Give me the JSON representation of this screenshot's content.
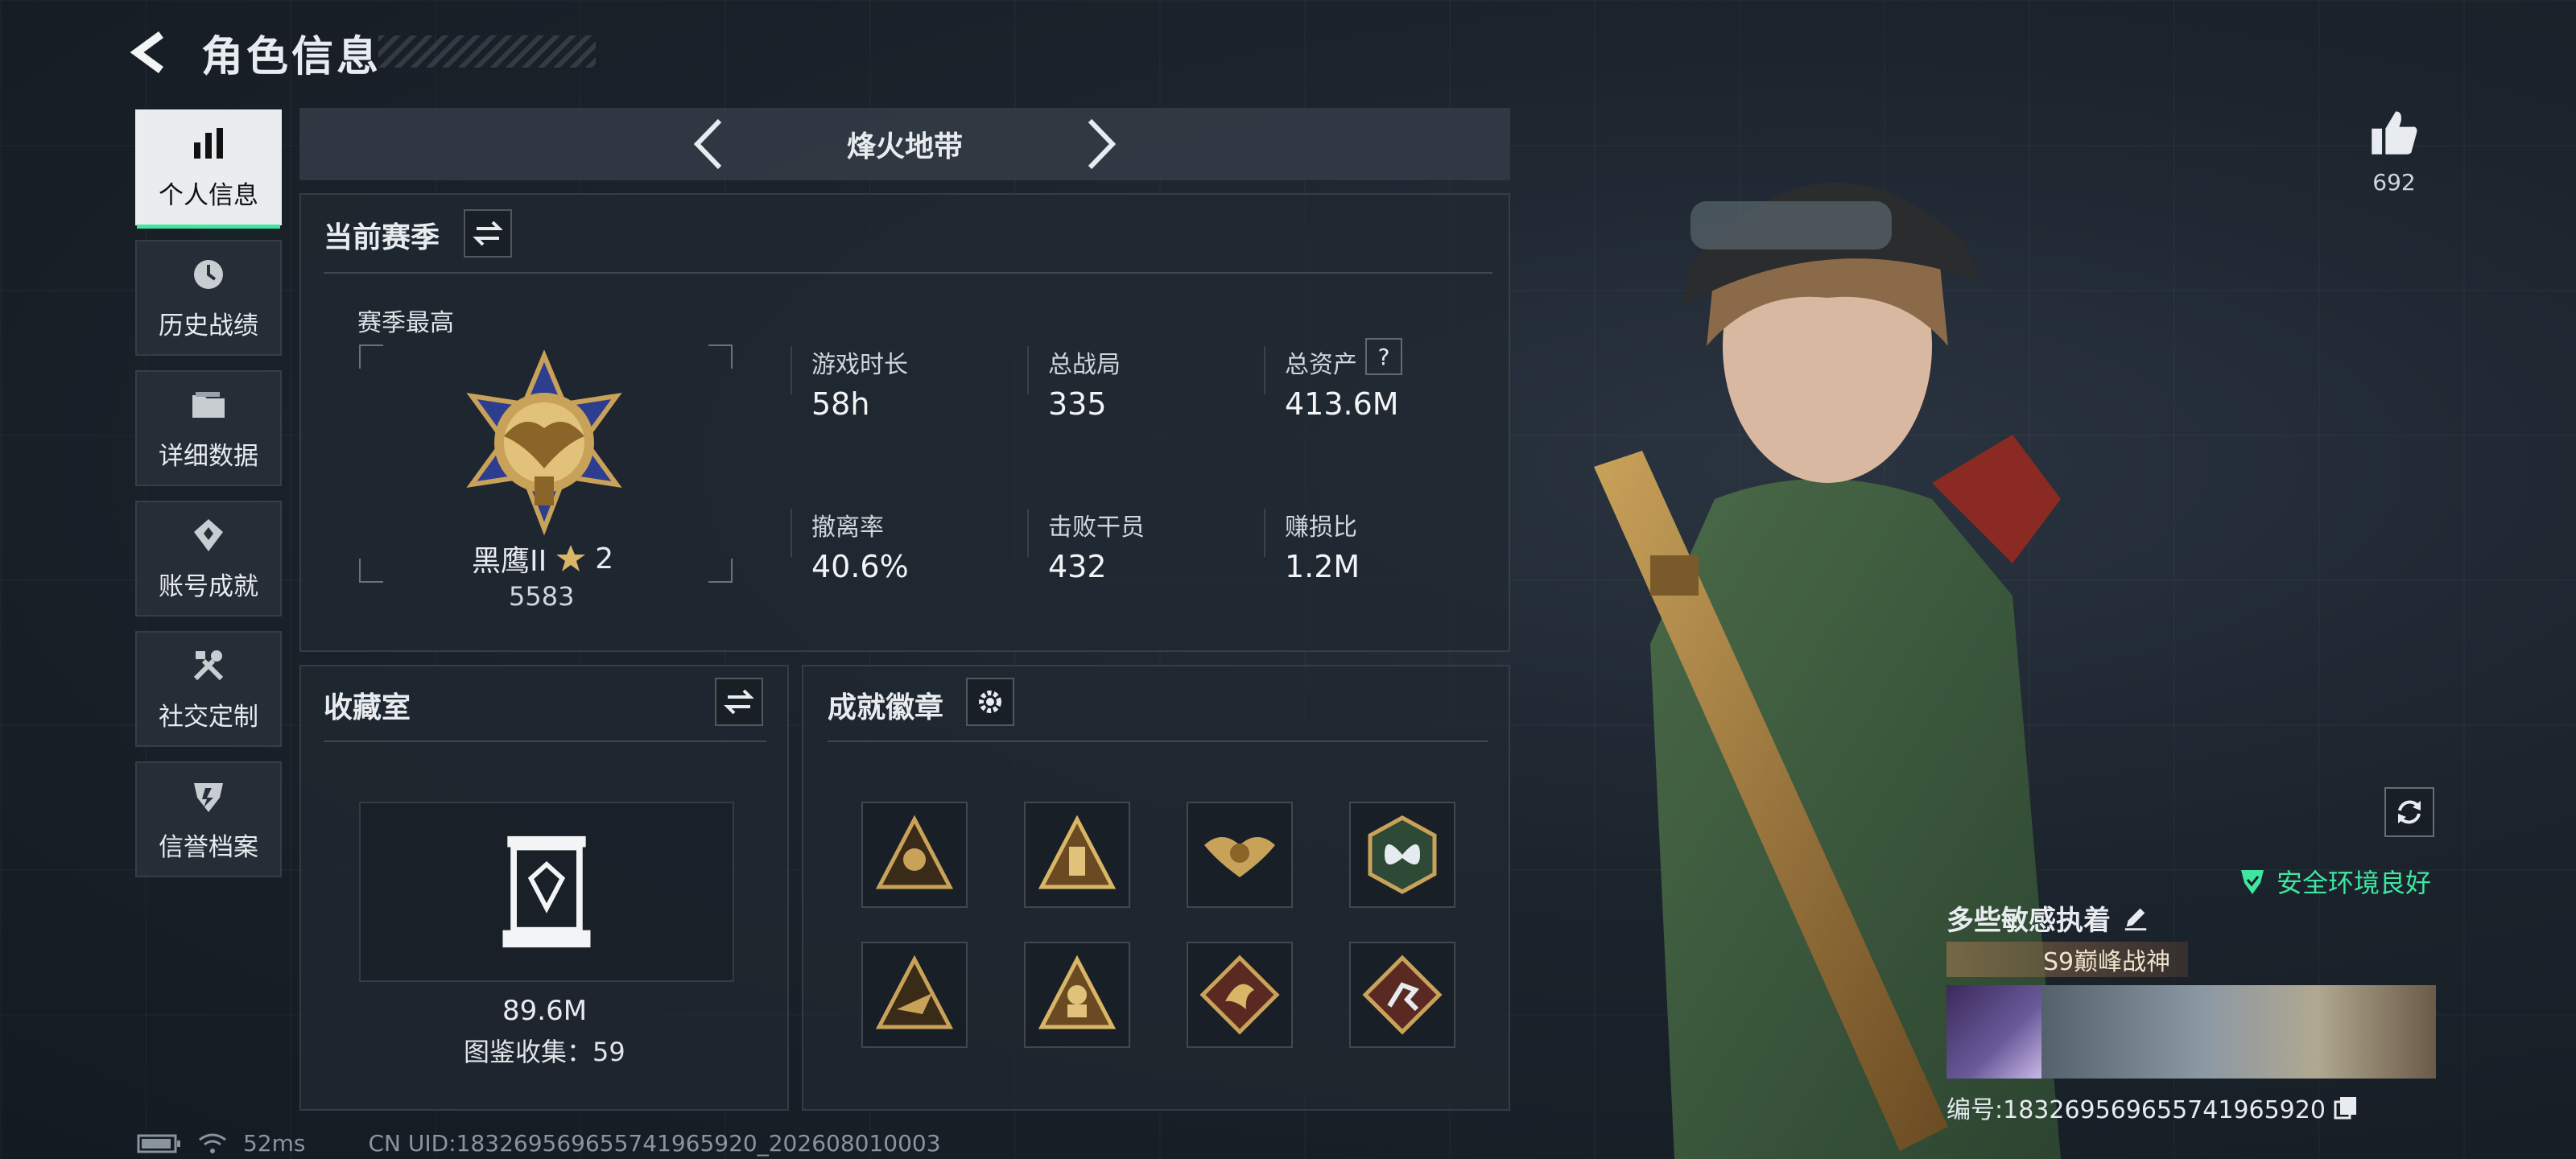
{
  "header": {
    "title": "角色信息"
  },
  "sidebar": {
    "items": [
      {
        "label": "个人信息",
        "icon": "bar-chart-icon",
        "active": true
      },
      {
        "label": "历史战绩",
        "icon": "history-clock-icon",
        "active": false
      },
      {
        "label": "详细数据",
        "icon": "folder-icon",
        "active": false
      },
      {
        "label": "账号成就",
        "icon": "achievement-badge-icon",
        "active": false
      },
      {
        "label": "社交定制",
        "icon": "tools-icon",
        "active": false
      },
      {
        "label": "信誉档案",
        "icon": "shield-icon",
        "active": false
      }
    ]
  },
  "mode_tab": {
    "label": "烽火地带"
  },
  "season": {
    "title": "当前赛季",
    "best_label": "赛季最高",
    "rank_name": "黑鹰II",
    "rank_stars": "2",
    "rank_score": "5583",
    "stats": [
      {
        "label": "游戏时长",
        "value": "58h"
      },
      {
        "label": "总战局",
        "value": "335"
      },
      {
        "label": "总资产",
        "value": "413.6M",
        "has_help": true,
        "help": "?"
      },
      {
        "label": "撤离率",
        "value": "40.6%"
      },
      {
        "label": "击败干员",
        "value": "432"
      },
      {
        "label": "赚损比",
        "value": "1.2M"
      }
    ]
  },
  "collection": {
    "title": "收藏室",
    "value": "89.6M",
    "count_text": "图鉴收集：59"
  },
  "achievements": {
    "title": "成就徽章",
    "badges": [
      {
        "icon": "skull-triangle-badge-icon"
      },
      {
        "icon": "tower-triangle-badge-icon"
      },
      {
        "icon": "eagle-wings-badge-icon"
      },
      {
        "icon": "butterfly-hexagon-badge-icon"
      },
      {
        "icon": "plane-triangle-badge-icon"
      },
      {
        "icon": "soldier-triangle-badge-icon"
      },
      {
        "icon": "dragon-diamond-badge-icon"
      },
      {
        "icon": "runner-diamond-badge-icon"
      }
    ]
  },
  "status": {
    "ping": "52ms",
    "uid": "CN UID:18326956965574196592​0_202608010003"
  },
  "profile": {
    "likes": "692",
    "safety": "安全环境良好",
    "player_name": "多些敏感执着",
    "title_badge": "S9巅峰战神",
    "serial": "编号:18326956965574196592​0"
  },
  "colors": {
    "accent": "#3fe6a0",
    "gold": "#c9a25a"
  }
}
